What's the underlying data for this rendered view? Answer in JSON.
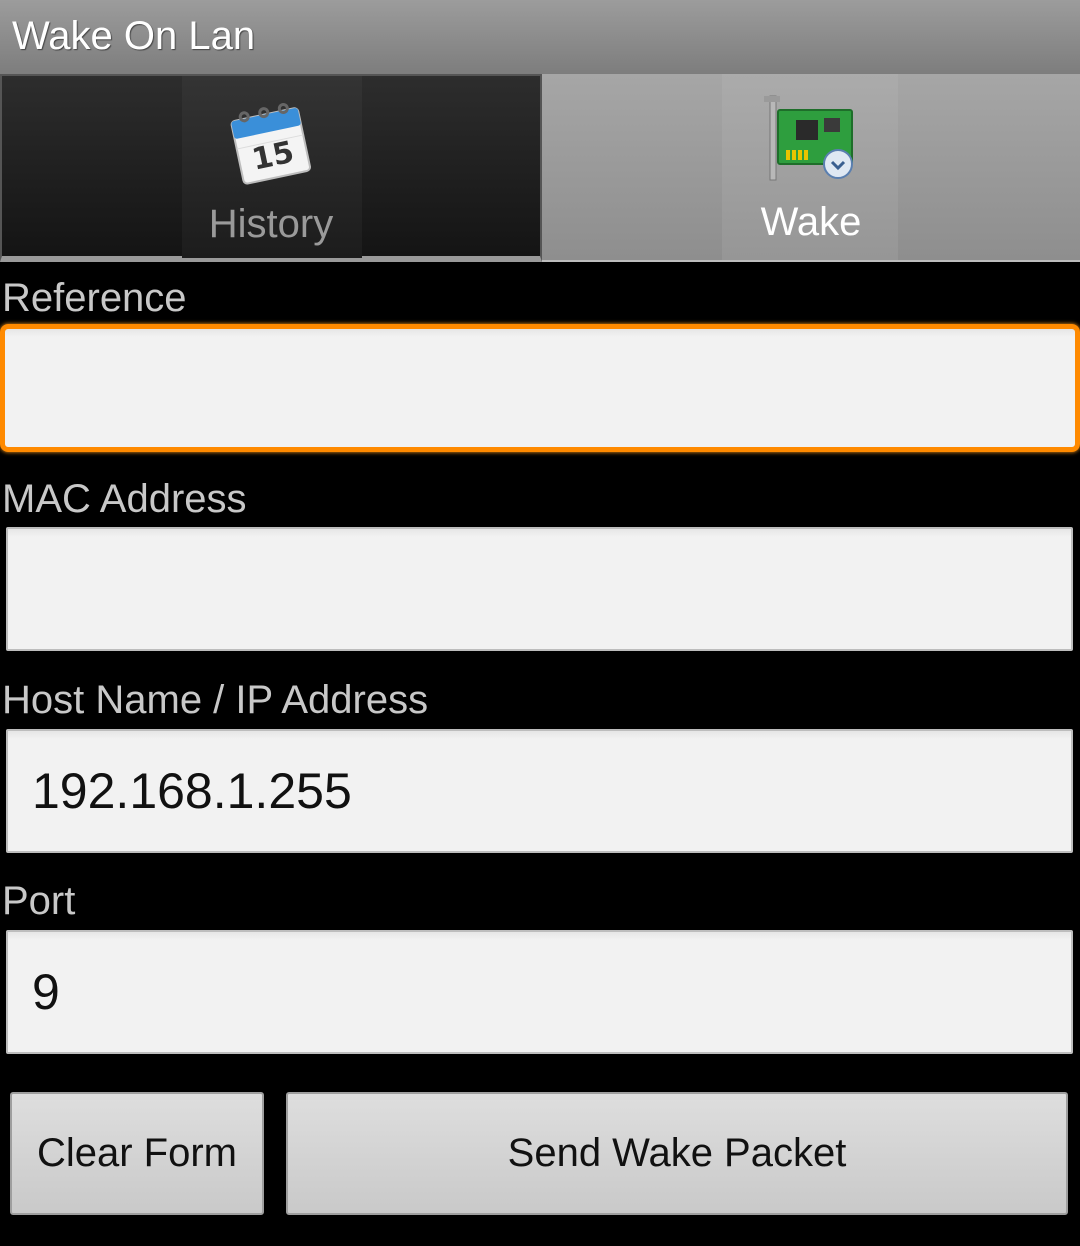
{
  "app": {
    "title": "Wake On Lan"
  },
  "tabs": [
    {
      "label": "History",
      "icon": "calendar-icon",
      "calendar_day": "15",
      "selected": false
    },
    {
      "label": "Wake",
      "icon": "network-card-icon",
      "selected": true
    }
  ],
  "form": {
    "reference": {
      "label": "Reference",
      "value": ""
    },
    "mac": {
      "label": "MAC Address",
      "value": ""
    },
    "host": {
      "label": "Host Name / IP Address",
      "value": "192.168.1.255"
    },
    "port": {
      "label": "Port",
      "value": "9"
    }
  },
  "buttons": {
    "clear_label": "Clear Form",
    "send_label": "Send Wake Packet"
  },
  "colors": {
    "focus_border": "#ff8a00",
    "background": "#000000",
    "titlebar": "#8c8c8c"
  }
}
